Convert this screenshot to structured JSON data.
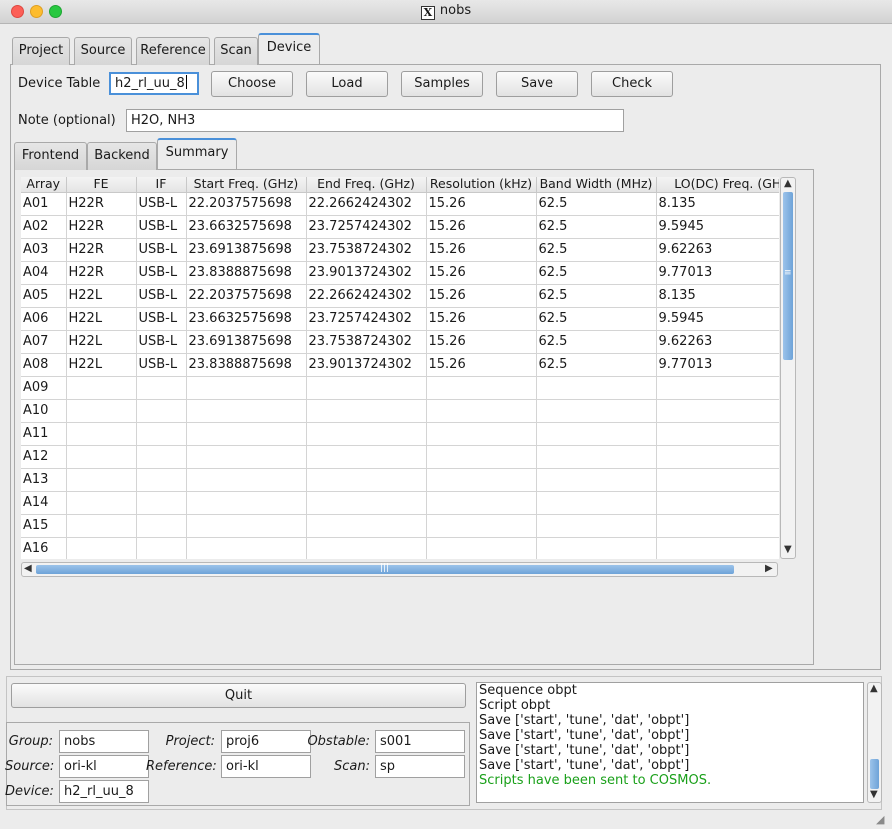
{
  "window": {
    "title": "nobs"
  },
  "main_tabs": [
    "Project",
    "Source",
    "Reference",
    "Scan",
    "Device"
  ],
  "device": {
    "table_label": "Device Table",
    "table_value": "h2_rl_uu_8",
    "buttons": {
      "choose": "Choose",
      "load": "Load",
      "samples": "Samples",
      "save": "Save",
      "check": "Check"
    },
    "note_label": "Note (optional)",
    "note_value": "H2O, NH3"
  },
  "sub_tabs": [
    "Frontend",
    "Backend",
    "Summary"
  ],
  "summary_table": {
    "columns": [
      "Array",
      "FE",
      "IF",
      "Start Freq. (GHz)",
      "End Freq. (GHz)",
      "Resolution (kHz)",
      "Band Width (MHz)",
      "LO(DC) Freq. (GHz)"
    ],
    "rows": [
      [
        "A01",
        "H22R",
        "USB-L",
        "22.2037575698",
        "22.2662424302",
        "15.26",
        "62.5",
        "8.135"
      ],
      [
        "A02",
        "H22R",
        "USB-L",
        "23.6632575698",
        "23.7257424302",
        "15.26",
        "62.5",
        "9.5945"
      ],
      [
        "A03",
        "H22R",
        "USB-L",
        "23.6913875698",
        "23.7538724302",
        "15.26",
        "62.5",
        "9.62263"
      ],
      [
        "A04",
        "H22R",
        "USB-L",
        "23.8388875698",
        "23.9013724302",
        "15.26",
        "62.5",
        "9.77013"
      ],
      [
        "A05",
        "H22L",
        "USB-L",
        "22.2037575698",
        "22.2662424302",
        "15.26",
        "62.5",
        "8.135"
      ],
      [
        "A06",
        "H22L",
        "USB-L",
        "23.6632575698",
        "23.7257424302",
        "15.26",
        "62.5",
        "9.5945"
      ],
      [
        "A07",
        "H22L",
        "USB-L",
        "23.6913875698",
        "23.7538724302",
        "15.26",
        "62.5",
        "9.62263"
      ],
      [
        "A08",
        "H22L",
        "USB-L",
        "23.8388875698",
        "23.9013724302",
        "15.26",
        "62.5",
        "9.77013"
      ],
      [
        "A09",
        "",
        "",
        "",
        "",
        "",
        "",
        ""
      ],
      [
        "A10",
        "",
        "",
        "",
        "",
        "",
        "",
        ""
      ],
      [
        "A11",
        "",
        "",
        "",
        "",
        "",
        "",
        ""
      ],
      [
        "A12",
        "",
        "",
        "",
        "",
        "",
        "",
        ""
      ],
      [
        "A13",
        "",
        "",
        "",
        "",
        "",
        "",
        ""
      ],
      [
        "A14",
        "",
        "",
        "",
        "",
        "",
        "",
        ""
      ],
      [
        "A15",
        "",
        "",
        "",
        "",
        "",
        "",
        ""
      ],
      [
        "A16",
        "",
        "",
        "",
        "",
        "",
        "",
        ""
      ]
    ]
  },
  "quit_label": "Quit",
  "status": {
    "group_label": "Group:",
    "group_value": "nobs",
    "project_label": "Project:",
    "project_value": "proj6",
    "obstable_label": "Obstable:",
    "obstable_value": "s001",
    "source_label": "Source:",
    "source_value": "ori-kl",
    "reference_label": "Reference:",
    "reference_value": "ori-kl",
    "scan_label": "Scan:",
    "scan_value": "sp",
    "device_label": "Device:",
    "device_value": "h2_rl_uu_8"
  },
  "log": {
    "lines": [
      "Sequence obpt",
      "Script obpt",
      "Save ['start', 'tune', 'dat', 'obpt']",
      "Save ['start', 'tune', 'dat', 'obpt']",
      "Save ['start', 'tune', 'dat', 'obpt']",
      "Save ['start', 'tune', 'dat', 'obpt']"
    ],
    "success": "Scripts have been sent to COSMOS."
  },
  "colors": {
    "accent": "#4a90d9",
    "success_text": "#1aa01a",
    "scroll_thumb": "#7fb0e0"
  }
}
